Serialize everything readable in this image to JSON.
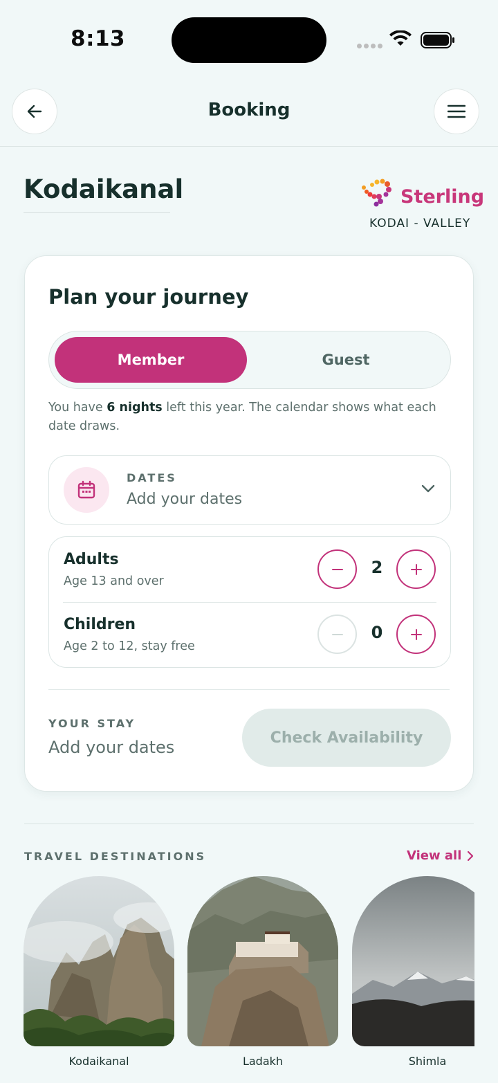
{
  "status_bar": {
    "time": "8:13"
  },
  "header": {
    "title": "Booking"
  },
  "location": {
    "title": "Kodaikanal"
  },
  "brand": {
    "name": "Sterling",
    "subtitle": "KODAI - VALLEY",
    "accent": "#c8377a"
  },
  "plan": {
    "title": "Plan your journey",
    "toggle": {
      "member": "Member",
      "guest": "Guest",
      "selected": "Member"
    },
    "nights_prefix": "You have ",
    "nights_bold": "6 nights",
    "nights_suffix": " left this year. The calendar shows what each date draws.",
    "dates": {
      "label": "DATES",
      "value": "Add your dates"
    },
    "guests": {
      "adults": {
        "label": "Adults",
        "sub": "Age 13 and over",
        "count": "2"
      },
      "children": {
        "label": "Children",
        "sub": "Age 2 to 12, stay free",
        "count": "0"
      }
    },
    "stay": {
      "label": "YOUR STAY",
      "value": "Add your dates"
    },
    "check_button": "Check Availability"
  },
  "destinations": {
    "label": "TRAVEL DESTINATIONS",
    "view_all": "View all",
    "items": [
      {
        "name": "Kodaikanal"
      },
      {
        "name": "Ladakh"
      },
      {
        "name": "Shimla"
      }
    ]
  },
  "colors": {
    "primary": "#c2327a",
    "background": "#f1f8f8",
    "text": "#17302c"
  }
}
